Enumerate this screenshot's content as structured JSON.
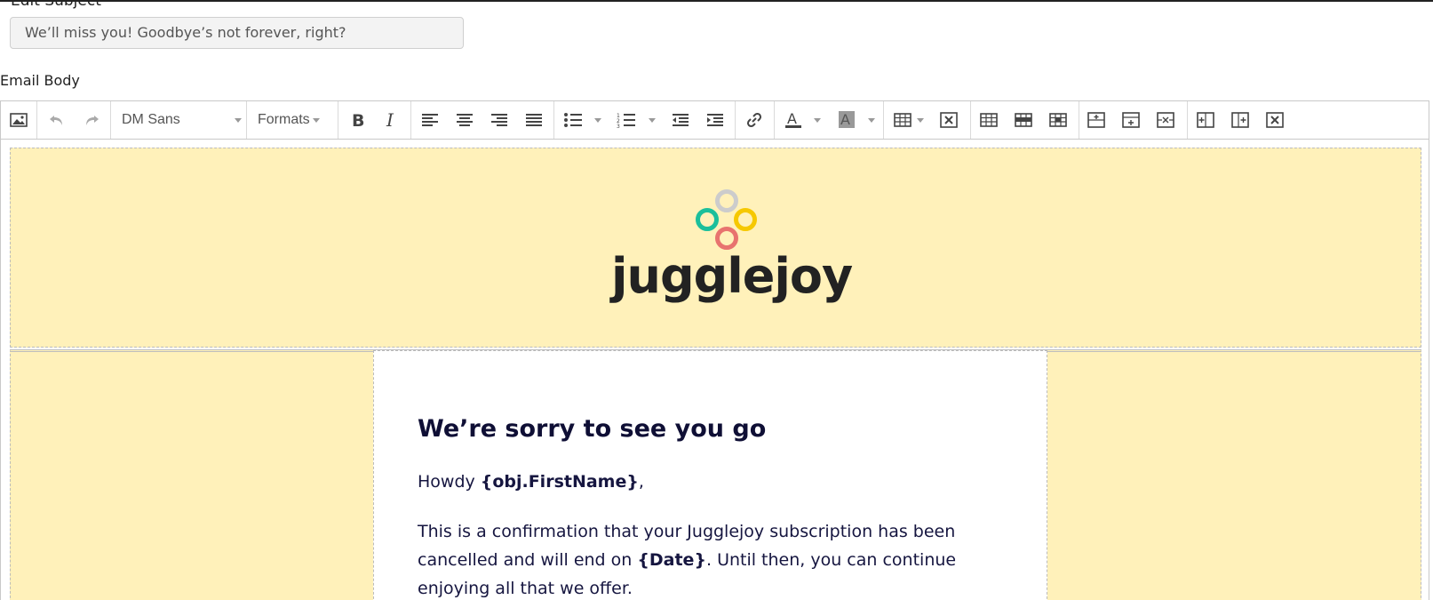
{
  "subject": {
    "label": "Edit Subject",
    "value": "We’ll miss you! Goodbye’s not forever, right?"
  },
  "email_body": {
    "label": "Email Body"
  },
  "toolbar": {
    "font_family": "DM Sans",
    "formats": "Formats",
    "buttons": [
      "insert-image",
      "undo",
      "redo",
      "bold",
      "italic",
      "align-left",
      "align-center",
      "align-right",
      "justify",
      "bullet-list",
      "numbered-list",
      "outdent",
      "indent",
      "link",
      "text-color",
      "background-color",
      "table",
      "delete-table",
      "table-row-props",
      "table-cell-props",
      "merge-cells",
      "insert-row-before",
      "insert-row-after",
      "delete-row",
      "insert-col-before",
      "insert-col-after",
      "delete-col"
    ]
  },
  "email": {
    "logo_text": "jugglejoy",
    "logo_colors": {
      "top": "#cccccc",
      "left": "#1bbf9b",
      "right": "#f6c800",
      "bottom": "#e8736f"
    },
    "heading": "We’re sorry to see you go",
    "greeting_prefix": "Howdy ",
    "greeting_token": "{obj.FirstName}",
    "greeting_suffix": ",",
    "para1_a": "This is a confirmation that your Jugglejoy subscription has been cancelled and will end on ",
    "para1_token": "{Date}",
    "para1_b": ". Until then, you can continue enjoying all that we offer."
  },
  "colors": {
    "banner_background": "#fff1ba",
    "text_navy": "#131336"
  }
}
